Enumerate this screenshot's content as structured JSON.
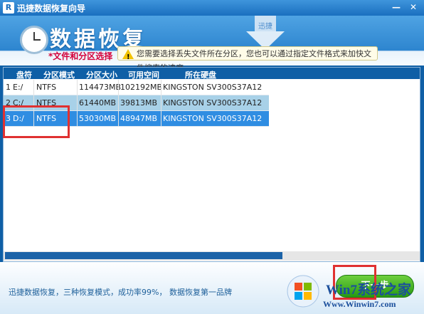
{
  "window": {
    "title": "迅捷数据恢复向导",
    "app_icon": "R",
    "min_glyph": "—",
    "close_glyph": "✕"
  },
  "header": {
    "brand": "数据恢复",
    "section_label": "*文件和分区选择",
    "tip": "您需要选择丢失文件所在分区，您也可以通过指定文件格式来加快文件搜索的速度",
    "download_label": "迅捷"
  },
  "table": {
    "columns": [
      "盘符",
      "分区模式",
      "分区大小",
      "可用空间",
      "所在硬盘"
    ],
    "rows": [
      {
        "index": "1",
        "drive": "E:/",
        "mode": "NTFS",
        "size": "114473MB",
        "free": "102192MB",
        "disk": "KINGSTON  SV300S37A12"
      },
      {
        "index": "2",
        "drive": "C:/",
        "mode": "NTFS",
        "size": "61440MB",
        "free": "39813MB",
        "disk": "KINGSTON  SV300S37A12"
      },
      {
        "index": "3",
        "drive": "D:/",
        "mode": "NTFS",
        "size": "53030MB",
        "free": "48947MB",
        "disk": "KINGSTON  SV300S37A12"
      }
    ],
    "selected_row": 3
  },
  "footer": {
    "tagline": "迅捷数据恢复，三种恢复模式，成功率99%， 数据恢复第一品牌",
    "next_label": "下一步"
  },
  "watermark": {
    "logo_text": "Win7系统之家",
    "url": "Www.Winwin7.com"
  },
  "colors": {
    "header_blue": "#2d85cf",
    "selected_row": "#2f8de2",
    "alt_row": "#a8d1e8",
    "highlight_red": "#e03131",
    "next_green": "#279a13"
  }
}
